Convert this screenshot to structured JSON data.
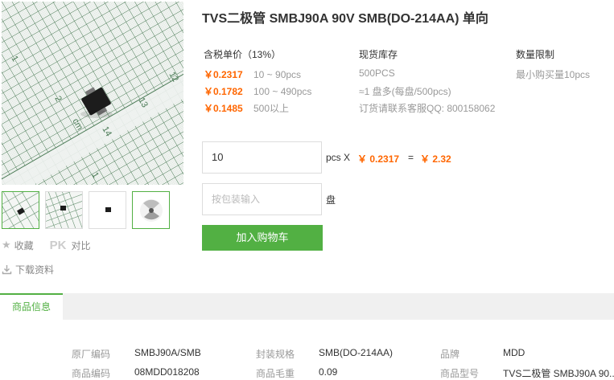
{
  "product": {
    "title": "TVS二极管 SMBJ90A 90V SMB(DO-214AA) 单向"
  },
  "pricing": {
    "header": "含税单价（13%）",
    "tiers": [
      {
        "price": "￥0.2317",
        "range": "10 ~ 90pcs"
      },
      {
        "price": "￥0.1782",
        "range": "100 ~ 490pcs"
      },
      {
        "price": "￥0.1485",
        "range": "500以上"
      }
    ]
  },
  "stock": {
    "header": "现货库存",
    "qty": "500PCS",
    "reel": "≈1 盘多(每盘/500pcs)",
    "contact": "订货请联系客服QQ: 800158062"
  },
  "limit": {
    "header": "数量限制",
    "min_buy": "最小购买量10pcs"
  },
  "order": {
    "qty_value": "10",
    "unit": "pcs X",
    "unit_price": "￥ 0.2317",
    "equals": "=",
    "total": "￥ 2.32",
    "pack_placeholder": "按包装输入",
    "pack_unit": "盘",
    "cart_label": "加入购物车"
  },
  "side": {
    "fav": "收藏",
    "pk": "PK",
    "compare": "对比",
    "download": "下载资料"
  },
  "tabs": {
    "active": "商品信息"
  },
  "specs": {
    "r1": [
      {
        "label": "原厂编码",
        "value": "SMBJ90A/SMB"
      },
      {
        "label": "封装规格",
        "value": "SMB(DO-214AA)"
      },
      {
        "label": "品牌",
        "value": "MDD"
      }
    ],
    "r2": [
      {
        "label": "商品编码",
        "value": "08MDD018208"
      },
      {
        "label": "商品毛重",
        "value": "0.09"
      },
      {
        "label": "商品型号",
        "value": "TVS二极管 SMBJ90A 90..."
      }
    ]
  },
  "ruler_labels": [
    "1",
    "2",
    "12",
    "13",
    "14",
    "cm",
    "2",
    "1"
  ],
  "colors": {
    "accent": "#52b043",
    "price": "#ff6600"
  }
}
